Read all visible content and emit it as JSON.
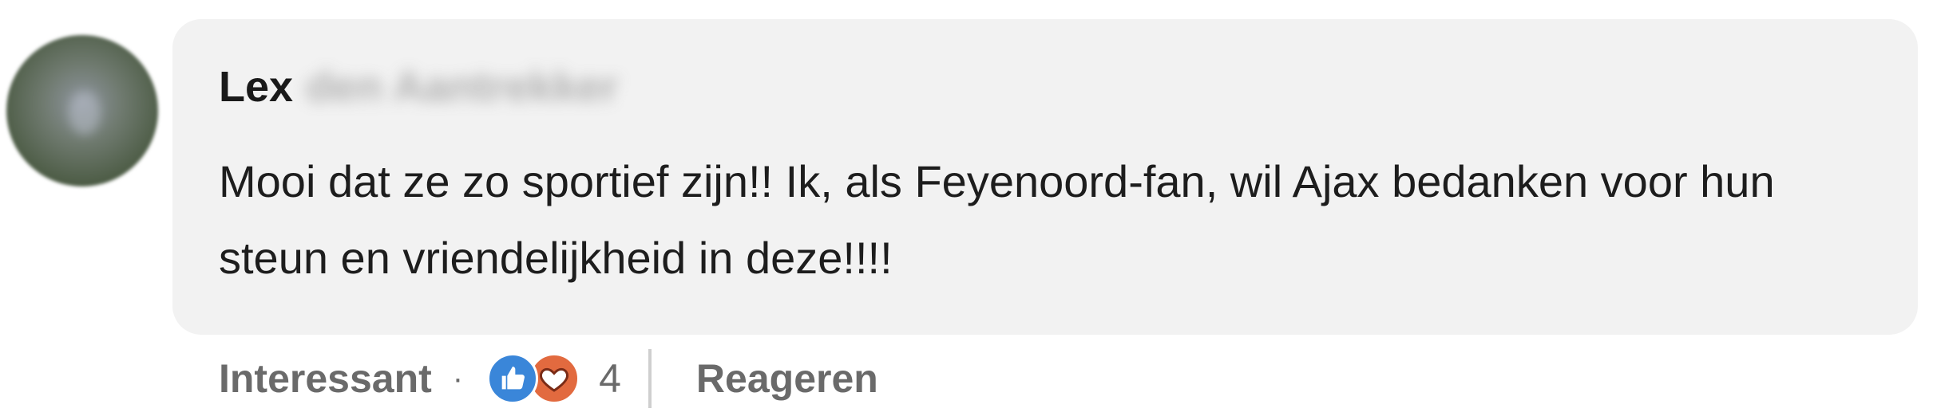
{
  "comment": {
    "author_first": "Lex",
    "author_last": "den Aantrekker",
    "text": "Mooi dat ze zo sportief zijn!! Ik, als Feyenoord-fan, wil Ajax bedanken voor hun steun en vriendelijkheid in deze!!!!"
  },
  "actions": {
    "interesting_label": "Interessant",
    "separator": "·",
    "reaction_icons": [
      "like-icon",
      "love-icon"
    ],
    "reaction_count": "4",
    "reply_label": "Reageren"
  },
  "colors": {
    "bubble": "#f2f2f2",
    "like": "#3a86d9",
    "love": "#e26a3f",
    "muted_text": "#6a6a6a"
  }
}
